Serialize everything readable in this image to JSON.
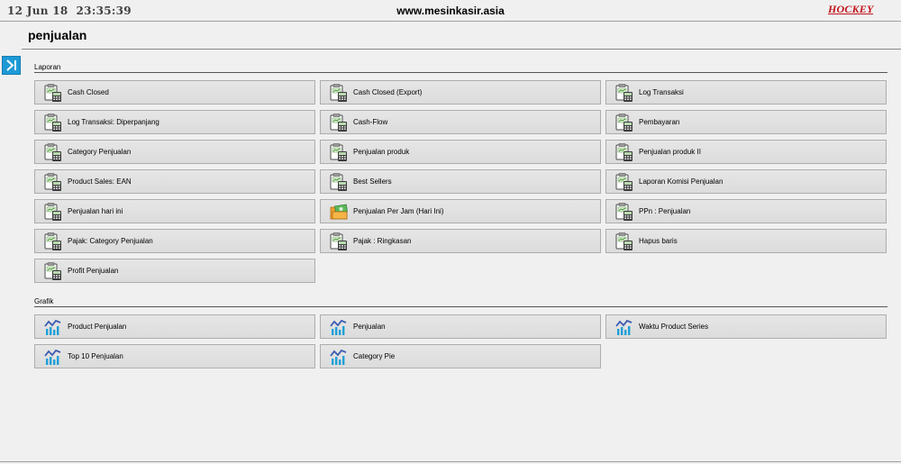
{
  "header": {
    "datetime": "12 Jun 18  23:35:39",
    "site": "www.mesinkasir.asia",
    "logo_text": "HOCKEY"
  },
  "page": {
    "title": "penjualan"
  },
  "colors": {
    "accent": "#1e9ad6",
    "logo": "#c0141c",
    "button_bg": "#e0e0e0",
    "background": "#f0f0f0"
  },
  "sections": {
    "laporan": {
      "label": "Laporan",
      "items": [
        {
          "label": "Cash Closed",
          "icon": "clipboard-calculator-icon"
        },
        {
          "label": "Cash Closed (Export)",
          "icon": "clipboard-calculator-icon"
        },
        {
          "label": "Log Transaksi",
          "icon": "clipboard-calculator-icon"
        },
        {
          "label": "Log Transaksi: Diperpanjang",
          "icon": "clipboard-calculator-icon"
        },
        {
          "label": "Cash-Flow",
          "icon": "clipboard-calculator-icon"
        },
        {
          "label": "Pembayaran",
          "icon": "clipboard-calculator-icon"
        },
        {
          "label": "Category Penjualan",
          "icon": "clipboard-calculator-icon"
        },
        {
          "label": "Penjualan produk",
          "icon": "clipboard-calculator-icon"
        },
        {
          "label": "Penjualan produk II",
          "icon": "clipboard-calculator-icon"
        },
        {
          "label": "Product Sales: EAN",
          "icon": "clipboard-calculator-icon"
        },
        {
          "label": "Best Sellers",
          "icon": "clipboard-calculator-icon"
        },
        {
          "label": "Laporan Komisi Penjualan",
          "icon": "clipboard-calculator-icon"
        },
        {
          "label": "Penjualan hari ini",
          "icon": "clipboard-calculator-icon"
        },
        {
          "label": "Penjualan Per Jam (Hari Ini)",
          "icon": "money-folder-icon"
        },
        {
          "label": "PPn : Penjualan",
          "icon": "clipboard-calculator-icon"
        },
        {
          "label": "Pajak: Category Penjualan",
          "icon": "clipboard-calculator-icon"
        },
        {
          "label": "Pajak : Ringkasan",
          "icon": "clipboard-calculator-icon"
        },
        {
          "label": "Hapus baris",
          "icon": "clipboard-calculator-icon"
        },
        {
          "label": "Profit Penjualan",
          "icon": "clipboard-calculator-icon"
        }
      ]
    },
    "grafik": {
      "label": "Grafik",
      "items": [
        {
          "label": "Product Penjualan",
          "icon": "bar-chart-icon"
        },
        {
          "label": "Penjualan",
          "icon": "bar-chart-icon"
        },
        {
          "label": "Waktu Product Series",
          "icon": "bar-chart-icon"
        },
        {
          "label": "Top 10 Penjualan",
          "icon": "bar-chart-icon"
        },
        {
          "label": "Category Pie",
          "icon": "bar-chart-icon"
        }
      ]
    }
  }
}
